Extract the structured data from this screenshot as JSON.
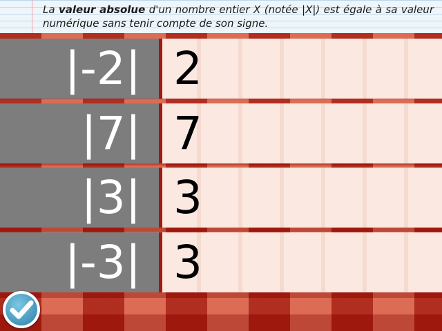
{
  "header": {
    "intro_1": "La ",
    "term": "valeur absolue",
    "intro_2": " d'un nombre entier X (notée |X|) est égale à sa valeur numérique sans tenir compte de son signe."
  },
  "rows": [
    {
      "expression": "|-2|",
      "answer": "2"
    },
    {
      "expression": "|7|",
      "answer": "7"
    },
    {
      "expression": "|3|",
      "answer": "3"
    },
    {
      "expression": "|-3|",
      "answer": "3"
    }
  ],
  "colors": {
    "accent": "#a82a1c",
    "left_panel": "#7d7d7d",
    "right_panel": "#fbe9e1"
  },
  "icons": {
    "check_button": "check-icon"
  }
}
